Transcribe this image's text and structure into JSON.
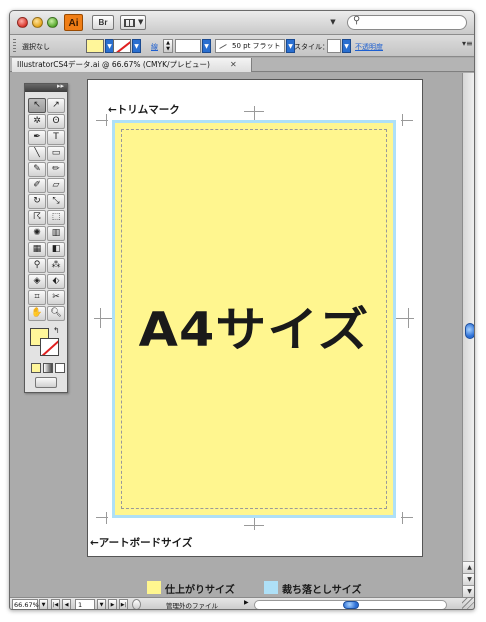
{
  "app": {
    "logo_text": "Ai",
    "bridge_label": "Br"
  },
  "control_bar": {
    "selection_status": "選択なし",
    "stroke_weight_label": "線",
    "brush_label": "50 pt フラット",
    "style_label": "スタイル：",
    "opacity_label": "不透明度"
  },
  "document": {
    "tab_title": "IllustratorCS4データ.ai @ 66.67% (CMYK/プレビュー)",
    "tab_close": "✕"
  },
  "artboard": {
    "heading": "A4サイズ",
    "trim_callout": "←トリムマーク",
    "artboard_callout": "←アートボードサイズ"
  },
  "legend": {
    "items": [
      {
        "label": "仕上がりサイズ",
        "color": "#fff68f"
      },
      {
        "label": "裁ち落としサイズ",
        "color": "#aee0f7"
      }
    ]
  },
  "status_bar": {
    "zoom": "66.67%",
    "page": "1",
    "status_text": "管理外のファイル"
  },
  "colors": {
    "fill": "#fff69a",
    "bleed": "#aee0f7",
    "trim": "#fff68f",
    "stroke_none_slash": "#e02020",
    "accent": "#2c6fd6"
  }
}
